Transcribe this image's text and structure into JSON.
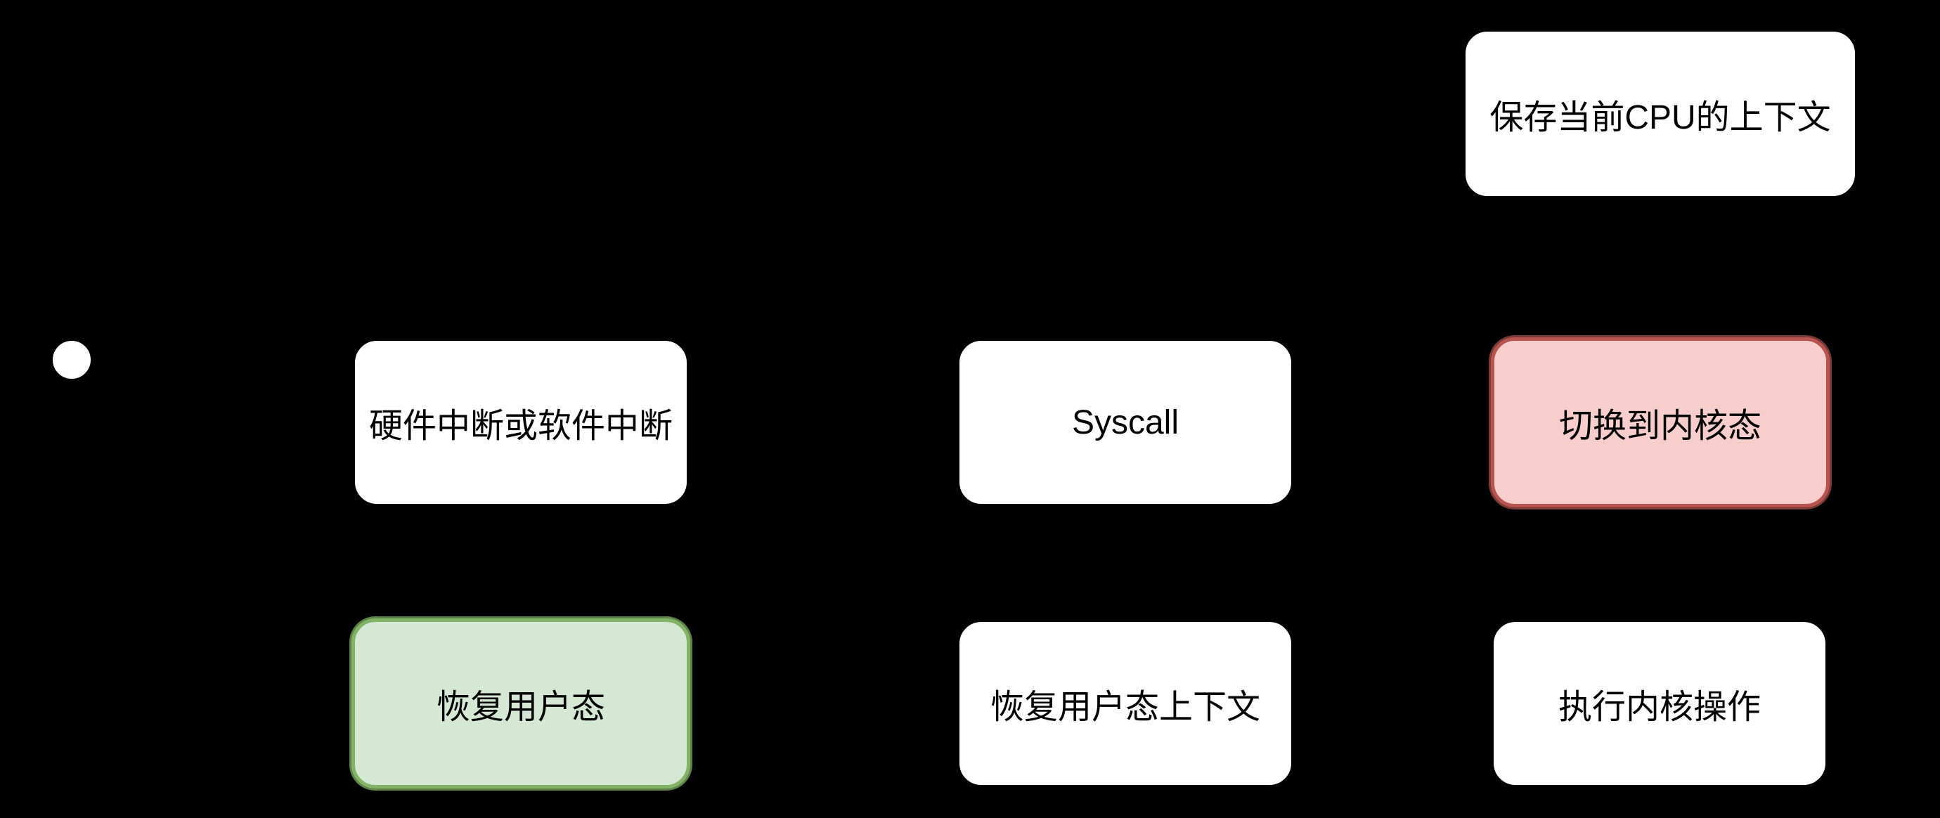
{
  "diagram": {
    "start": {},
    "nodes": {
      "save_context": "保存当前CPU的上下文",
      "interrupt": "硬件中断或软件中断",
      "syscall": "Syscall",
      "switch_kernel": "切换到内核态",
      "restore_user": "恢复用户态",
      "restore_user_context": "恢复用户态上下文",
      "exec_kernel": "执行内核操作"
    },
    "colors": {
      "background": "#000000",
      "node_fill": "#ffffff",
      "switch_kernel_fill": "#f8cecc",
      "switch_kernel_stroke": "#b85450",
      "restore_user_fill": "#d5e8d4",
      "restore_user_stroke": "#82b366",
      "edge": "#000000"
    }
  }
}
